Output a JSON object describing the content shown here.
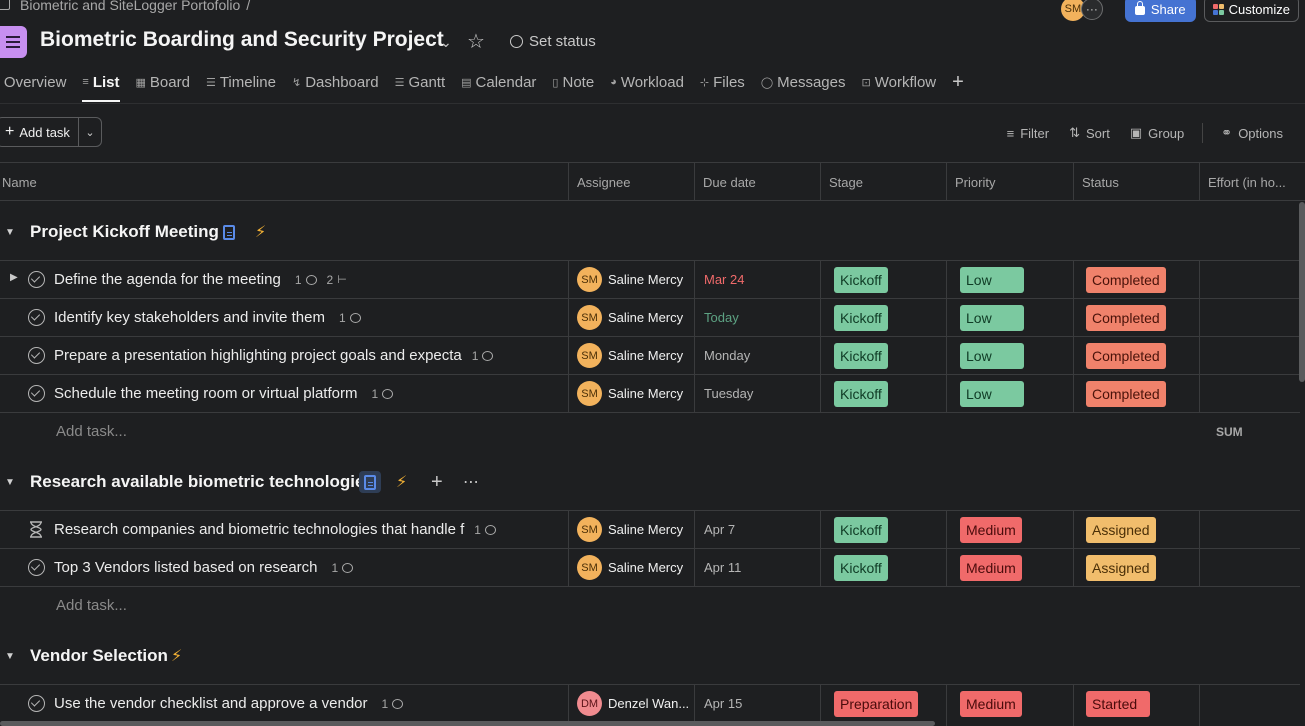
{
  "breadcrumb": {
    "portfolio": "Biometric and SiteLogger Portofolio",
    "separator": "/"
  },
  "topbar": {
    "avatar_initials": "SM",
    "more": "···",
    "share_label": "Share",
    "customize_label": "Customize"
  },
  "project": {
    "title": "Biometric Boarding and Security Project",
    "set_status_label": "Set status",
    "icon_color": "#c78ff0"
  },
  "tabs": [
    {
      "label": "Overview",
      "icon": "overview-icon"
    },
    {
      "label": "List",
      "icon": "list-icon",
      "active": true
    },
    {
      "label": "Board",
      "icon": "board-icon"
    },
    {
      "label": "Timeline",
      "icon": "timeline-icon"
    },
    {
      "label": "Dashboard",
      "icon": "dashboard-icon"
    },
    {
      "label": "Gantt",
      "icon": "gantt-icon"
    },
    {
      "label": "Calendar",
      "icon": "calendar-icon"
    },
    {
      "label": "Note",
      "icon": "note-icon"
    },
    {
      "label": "Workload",
      "icon": "workload-icon"
    },
    {
      "label": "Files",
      "icon": "files-icon"
    },
    {
      "label": "Messages",
      "icon": "messages-icon"
    },
    {
      "label": "Workflow",
      "icon": "workflow-icon"
    }
  ],
  "toolbar": {
    "add_task": "Add task",
    "filter": "Filter",
    "sort": "Sort",
    "group": "Group",
    "options": "Options"
  },
  "columns": {
    "name": "Name",
    "assignee": "Assignee",
    "due": "Due date",
    "stage": "Stage",
    "priority": "Priority",
    "status": "Status",
    "effort": "Effort (in ho..."
  },
  "sections": [
    {
      "title": "Project Kickoff Meeting",
      "tasks": [
        {
          "name": "Define the agenda for the meeting",
          "comments": "1",
          "subtasks": "2",
          "assignee": "Saline Mercy",
          "initials": "SM",
          "due": "Mar 24",
          "stage": "Kickoff",
          "priority": "Low",
          "status": "Completed"
        },
        {
          "name": "Identify key stakeholders and invite them",
          "comments": "1",
          "assignee": "Saline Mercy",
          "initials": "SM",
          "due": "Today",
          "stage": "Kickoff",
          "priority": "Low",
          "status": "Completed"
        },
        {
          "name": "Prepare a presentation highlighting project goals and expecta",
          "comments": "1",
          "assignee": "Saline Mercy",
          "initials": "SM",
          "due": "Monday",
          "stage": "Kickoff",
          "priority": "Low",
          "status": "Completed"
        },
        {
          "name": "Schedule the meeting room or virtual platform",
          "comments": "1",
          "assignee": "Saline Mercy",
          "initials": "SM",
          "due": "Tuesday",
          "stage": "Kickoff",
          "priority": "Low",
          "status": "Completed"
        }
      ],
      "add_task": "Add task...",
      "sum": "SUM"
    },
    {
      "title": "Research available biometric technologies",
      "tasks": [
        {
          "name": "Research companies and biometric technologies that handle f",
          "comments": "1",
          "assignee": "Saline Mercy",
          "initials": "SM",
          "due": "Apr 7",
          "stage": "Kickoff",
          "priority": "Medium",
          "status": "Assigned"
        },
        {
          "name": "Top 3 Vendors listed based on research",
          "comments": "1",
          "assignee": "Saline Mercy",
          "initials": "SM",
          "due": "Apr 11",
          "stage": "Kickoff",
          "priority": "Medium",
          "status": "Assigned"
        }
      ],
      "add_task": "Add task..."
    },
    {
      "title": "Vendor Selection",
      "tasks": [
        {
          "name": "Use the vendor checklist and approve a vendor",
          "comments": "1",
          "assignee": "Denzel Wan...",
          "initials": "DM",
          "due": "Apr 15",
          "stage": "Preparation",
          "priority": "Medium",
          "status": "Started"
        }
      ]
    }
  ]
}
